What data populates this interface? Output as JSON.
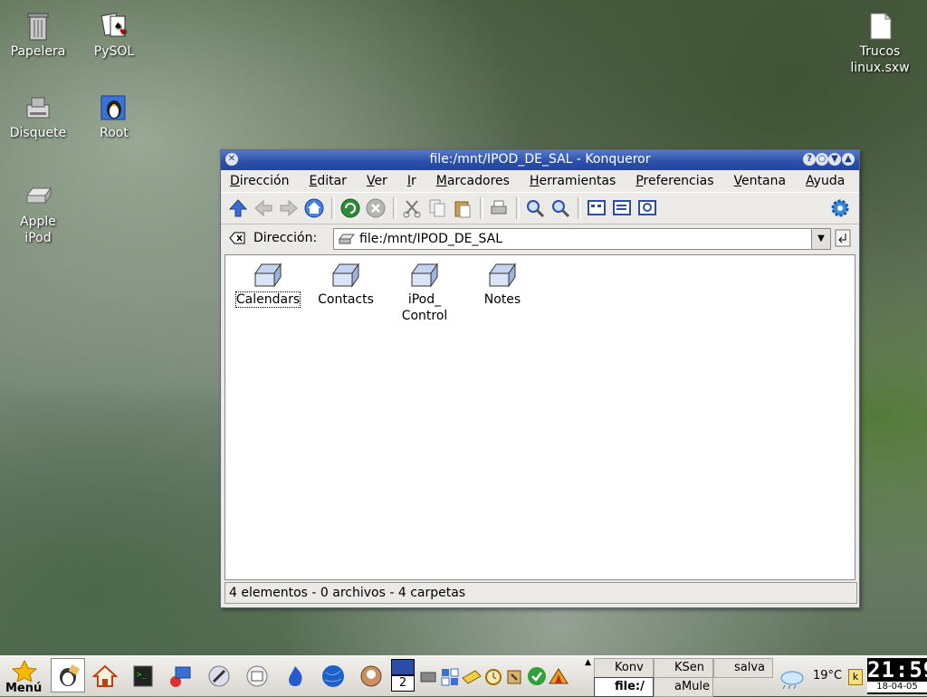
{
  "desktop": {
    "icons": [
      {
        "label": "Papelera",
        "icon": "trash-icon"
      },
      {
        "label": "PySOL",
        "icon": "cards-icon"
      },
      {
        "label": "Disquete",
        "icon": "floppy-icon"
      },
      {
        "label": "Root",
        "icon": "penguin-icon"
      },
      {
        "label": "Apple\niPod",
        "line1": "Apple",
        "line2": "iPod",
        "icon": "drive-icon"
      },
      {
        "label": "Trucos linux.sxw",
        "line1": "Trucos",
        "line2": "linux.sxw",
        "icon": "document-icon"
      }
    ]
  },
  "window": {
    "title": "file:/mnt/IPOD_DE_SAL - Konqueror",
    "menu": [
      "Dirección",
      "Editar",
      "Ver",
      "Ir",
      "Marcadores",
      "Herramientas",
      "Preferencias",
      "Ventana",
      "Ayuda"
    ],
    "location_label": "Dirección:",
    "location_value": "file:/mnt/IPOD_DE_SAL",
    "files": [
      {
        "name": "Calendars",
        "selected": true
      },
      {
        "name": "Contacts",
        "selected": false
      },
      {
        "name_line1": "iPod_",
        "name_line2": "Control",
        "selected": false
      },
      {
        "name": "Notes",
        "selected": false
      }
    ],
    "status": "4 elementos - 0 archivos - 4 carpetas"
  },
  "taskbar": {
    "menu_label": "Menú",
    "desktop_number": "2",
    "tasks": [
      "Konv",
      "KSen",
      "salva",
      "file:/",
      "aMule"
    ],
    "temperature": "19°C",
    "time": "21:59",
    "date": "18-04-05"
  },
  "colors": {
    "titlebar": "#2a4ea8",
    "window_bg": "#eceae6",
    "taskbar_bg": "#e4e1dc"
  }
}
